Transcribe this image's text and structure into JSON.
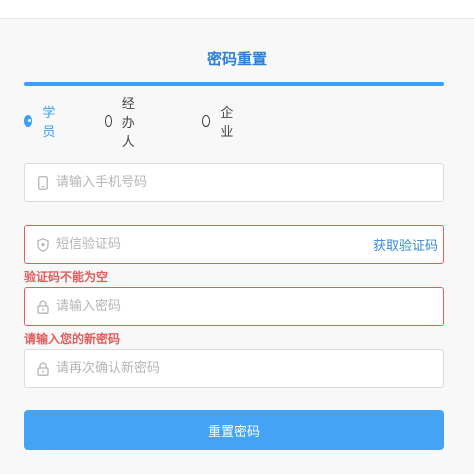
{
  "header": {
    "title": "密码重置"
  },
  "user_types": [
    {
      "label": "学员",
      "selected": true
    },
    {
      "label": "经办人",
      "selected": false
    },
    {
      "label": "企业",
      "selected": false
    }
  ],
  "fields": {
    "phone": {
      "placeholder": "请输入手机号码",
      "value": "",
      "icon": "phone-icon"
    },
    "code": {
      "placeholder": "短信验证码",
      "value": "",
      "icon": "shield-icon",
      "action_label": "获取验证码",
      "error": "验证码不能为空"
    },
    "password": {
      "placeholder": "请输入密码",
      "value": "",
      "icon": "lock-icon",
      "error": "请输入您的新密码"
    },
    "confirm": {
      "placeholder": "请再次确认新密码",
      "value": "",
      "icon": "lock-icon"
    }
  },
  "submit_label": "重置密码",
  "colors": {
    "accent": "#3aa0f5",
    "error": "#e25d5d",
    "link": "#3a8ad6"
  }
}
